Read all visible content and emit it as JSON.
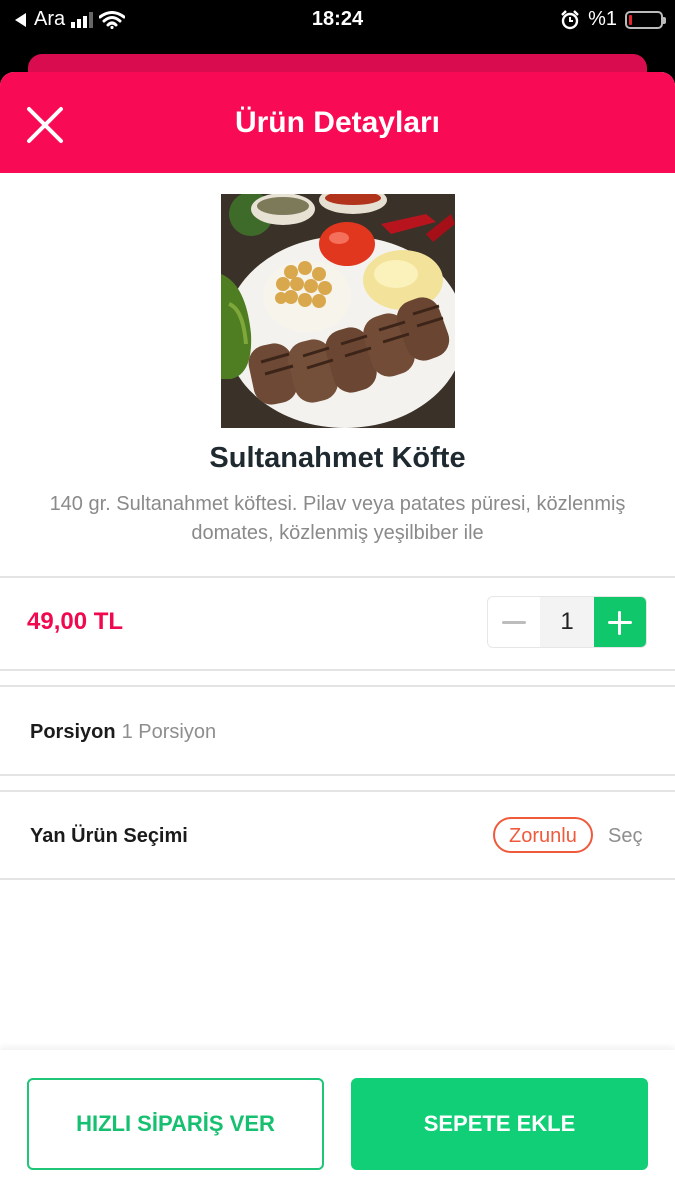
{
  "status_bar": {
    "carrier": "Ara",
    "time": "18:24",
    "battery_text": "%1",
    "icons": [
      "back-arrow-icon",
      "signal-icon",
      "wifi-icon",
      "alarm-icon",
      "battery-icon"
    ]
  },
  "header": {
    "title": "Ürün Detayları",
    "close_icon": "close-icon",
    "color": "#f90a54"
  },
  "product": {
    "name": "Sultanahmet Köfte",
    "description": "140 gr. Sultanahmet köftesi. Pilav veya patates püresi, közlenmiş domates, közlenmiş yeşilbiber ile",
    "price": "49,00 TL",
    "quantity": "1"
  },
  "options": {
    "portion": {
      "label": "Porsiyon",
      "value": "1 Porsiyon"
    },
    "side": {
      "label": "Yan Ürün Seçimi",
      "badge": "Zorunlu",
      "action": "Seç"
    }
  },
  "actions": {
    "quick_order": "HIZLI SİPARİŞ VER",
    "add_to_cart": "SEPETE EKLE"
  },
  "colors": {
    "accent_red": "#f0094f",
    "accent_green": "#10cf76",
    "badge_orange": "#f05a3c"
  }
}
